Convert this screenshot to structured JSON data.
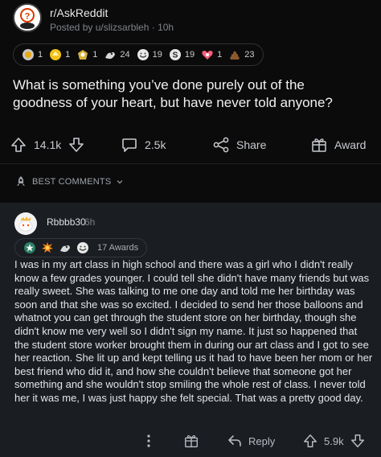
{
  "header": {
    "subreddit": "r/AskReddit",
    "posted_by": "Posted by u/slizsarbleh · 10h"
  },
  "post_awards": [
    {
      "icon": "silver-icon",
      "count": "1"
    },
    {
      "icon": "gold-icon",
      "count": "1"
    },
    {
      "icon": "platinum-icon",
      "count": "1"
    },
    {
      "icon": "wholesome-icon",
      "count": "24"
    },
    {
      "icon": "hugz-icon",
      "count": "19"
    },
    {
      "icon": "helpful-icon",
      "count": "19"
    },
    {
      "icon": "heart-icon",
      "count": "1"
    },
    {
      "icon": "poop-icon",
      "count": "23"
    }
  ],
  "post": {
    "title": "What is something you’ve done purely out of the goodness of your heart, but have never told anyone?",
    "upvotes": "14.1k",
    "comments": "2.5k",
    "share_label": "Share",
    "award_label": "Award"
  },
  "sort": {
    "label": "BEST COMMENTS"
  },
  "comment": {
    "username": "Rbbbb30",
    "time": "6h",
    "awards_count": "17 Awards",
    "body": "I was in my art class in high school and there was a girl who I didn't really know a few grades younger. I could tell she didn't have many friends but was really sweet. She was talking to me one day and told me her birthday was soon and that she was so excited. I decided to send her those balloons and whatnot you can get through the student store on her birthday, though she didn't know me very well so I didn't sign my name. It just so happened that the student store worker brought them in during our art class and I got to see her reaction. She lit up and kept telling us it had to have been her mom or her best friend who did it, and how she couldn't believe that someone got her something and she wouldn't stop smiling the whole rest of class. I never told her it was me, I was just happy she felt special. That was a pretty good day.",
    "reply_label": "Reply",
    "score": "5.9k"
  },
  "colors": {
    "post_bg": "#0b0b0c",
    "comment_bg": "#1a1d22",
    "text": "#d7dadc",
    "muted": "#7f8389"
  }
}
